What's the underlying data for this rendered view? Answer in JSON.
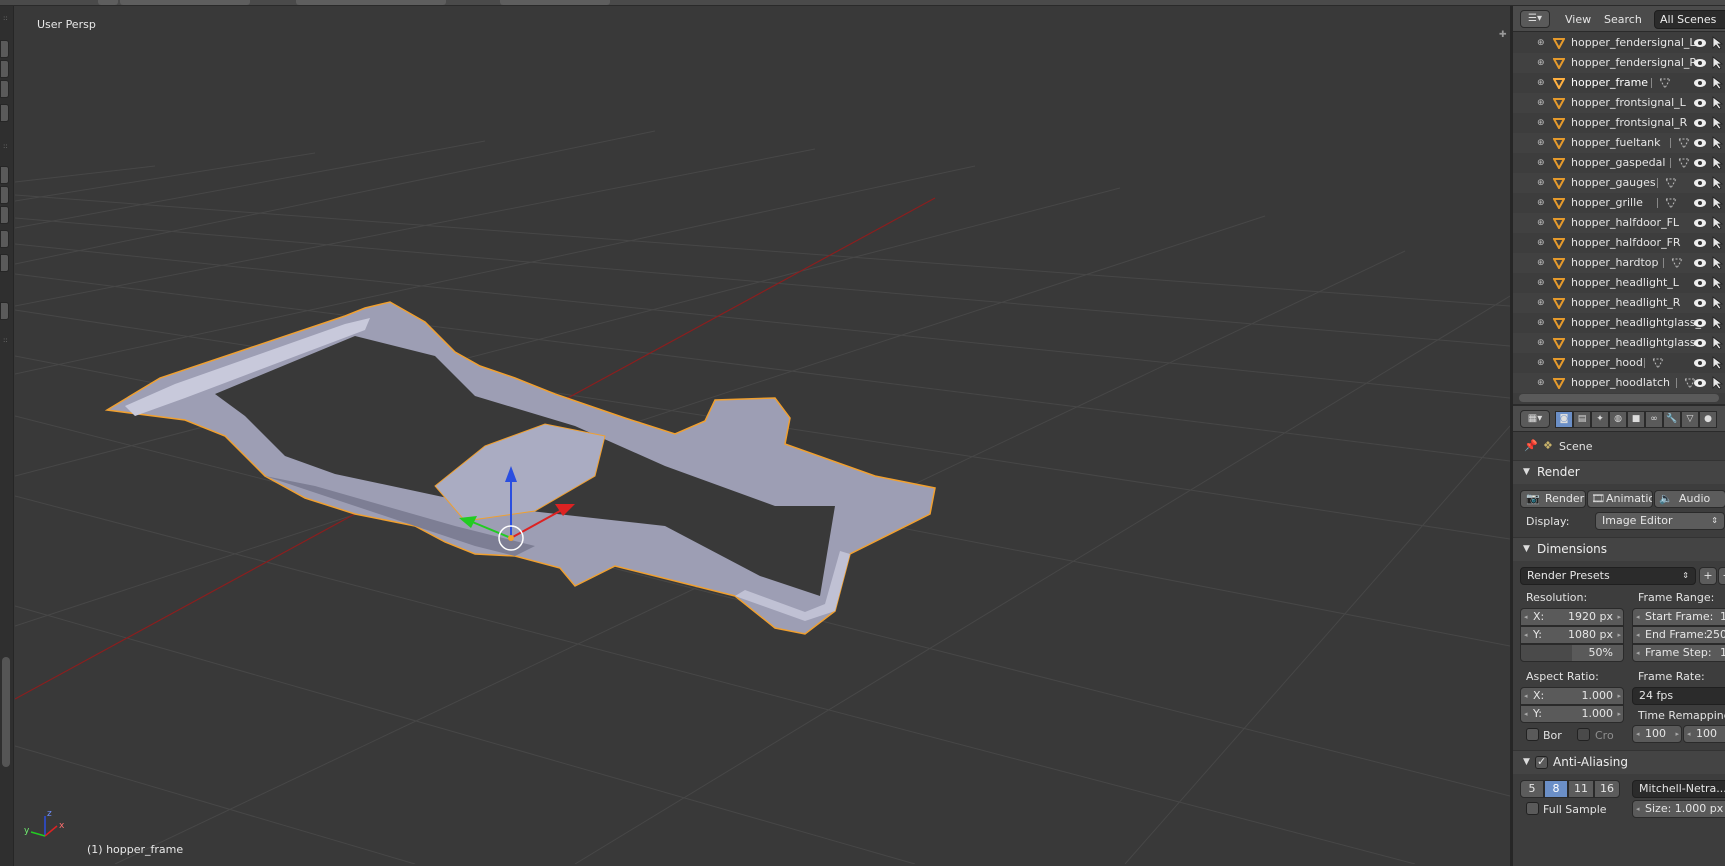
{
  "viewport": {
    "view_name": "User Persp",
    "active_object_label": "(1) hopper_frame",
    "axis_x": "x",
    "axis_y": "y",
    "axis_z": "z"
  },
  "outliner": {
    "menu_view": "View",
    "menu_search": "Search",
    "scene_filter": "All Scenes",
    "items": [
      {
        "name": "hopper_fendersignal_L",
        "active": false,
        "mesh": false
      },
      {
        "name": "hopper_fendersignal_R",
        "active": false,
        "mesh": false
      },
      {
        "name": "hopper_frame",
        "active": true,
        "mesh": true
      },
      {
        "name": "hopper_frontsignal_L",
        "active": false,
        "mesh": false
      },
      {
        "name": "hopper_frontsignal_R",
        "active": false,
        "mesh": false
      },
      {
        "name": "hopper_fueltank",
        "active": false,
        "mesh": true
      },
      {
        "name": "hopper_gaspedal",
        "active": false,
        "mesh": true
      },
      {
        "name": "hopper_gauges",
        "active": false,
        "mesh": true
      },
      {
        "name": "hopper_grille",
        "active": false,
        "mesh": true
      },
      {
        "name": "hopper_halfdoor_FL",
        "active": false,
        "mesh": false
      },
      {
        "name": "hopper_halfdoor_FR",
        "active": false,
        "mesh": false
      },
      {
        "name": "hopper_hardtop",
        "active": false,
        "mesh": true
      },
      {
        "name": "hopper_headlight_L",
        "active": false,
        "mesh": false
      },
      {
        "name": "hopper_headlight_R",
        "active": false,
        "mesh": false
      },
      {
        "name": "hopper_headlightglass_",
        "active": false,
        "mesh": false
      },
      {
        "name": "hopper_headlightglass",
        "active": false,
        "mesh": false
      },
      {
        "name": "hopper_hood",
        "active": false,
        "mesh": true
      },
      {
        "name": "hopper_hoodlatch",
        "active": false,
        "mesh": true
      }
    ]
  },
  "properties": {
    "scene_label": "Scene",
    "render_panel": {
      "title": "Render",
      "btn_render": "Render",
      "btn_animation": "Animation",
      "btn_audio": "Audio",
      "display_label": "Display:",
      "display_value": "Image Editor"
    },
    "dimensions_panel": {
      "title": "Dimensions",
      "presets": "Render Presets",
      "resolution_label": "Resolution:",
      "res_x_key": "X:",
      "res_x": "1920 px",
      "res_y_key": "Y:",
      "res_y": "1080 px",
      "res_pct": "50%",
      "frame_range_label": "Frame Range:",
      "start_frame_key": "Start Frame:",
      "start_frame": "1",
      "end_frame_key": "End Frame:",
      "end_frame": "250",
      "frame_step_key": "Frame Step:",
      "frame_step": "1",
      "aspect_label": "Aspect Ratio:",
      "aspect_x_key": "X:",
      "aspect_x": "1.000",
      "aspect_y_key": "Y:",
      "aspect_y": "1.000",
      "frame_rate_label": "Frame Rate:",
      "frame_rate": "24 fps",
      "time_remap_label": "Time Remapping:",
      "remap_old": "100",
      "remap_new": "100",
      "border_label": "Bor",
      "crop_label": "Cro"
    },
    "aa_panel": {
      "title": "Anti-Aliasing",
      "samples": [
        "5",
        "8",
        "11",
        "16"
      ],
      "selected_sample": "8",
      "filter": "Mitchell-Netra...",
      "full_sample": "Full Sample",
      "size": "Size: 1.000 px"
    }
  },
  "colors": {
    "viewport_bg": "#393939",
    "selection_outline": "#f0a030",
    "x_axis": "#b02020",
    "active_highlight": "#6b8fc7"
  }
}
